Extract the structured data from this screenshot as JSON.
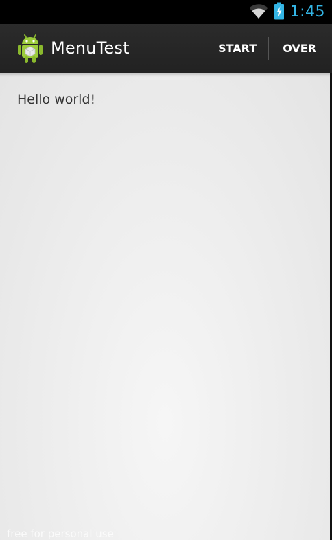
{
  "status_bar": {
    "time": "1:45",
    "wifi_icon": "wifi-icon",
    "battery_icon": "battery-charging-icon",
    "accent_color": "#33b5e5"
  },
  "action_bar": {
    "app_icon": "android-app-icon",
    "title": "MenuTest",
    "menu": {
      "start_label": "START",
      "over_label": "OVER"
    }
  },
  "content": {
    "hello_text": "Hello world!"
  },
  "watermark": {
    "text": "free for personal use"
  }
}
